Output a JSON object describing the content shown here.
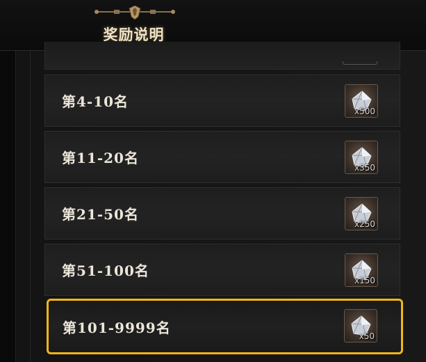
{
  "header": {
    "title": "奖励说明"
  },
  "rewards": [
    {
      "rank": "第4-10名",
      "icon": "crystal-icon",
      "quantity": "x500"
    },
    {
      "rank": "第11-20名",
      "icon": "crystal-icon",
      "quantity": "x350"
    },
    {
      "rank": "第21-50名",
      "icon": "crystal-icon",
      "quantity": "x250"
    },
    {
      "rank": "第51-100名",
      "icon": "crystal-icon",
      "quantity": "x150"
    },
    {
      "rank": "第101-9999名",
      "icon": "crystal-icon",
      "quantity": "x50",
      "selected": true
    }
  ],
  "colors": {
    "highlight": "#f2b51c",
    "title": "#f0e2c4",
    "frame": "#6b5a46"
  }
}
